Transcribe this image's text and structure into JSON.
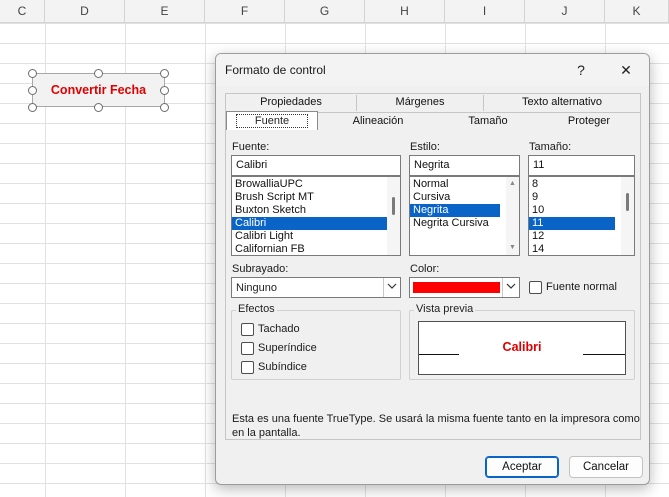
{
  "sheet": {
    "columns": [
      "C",
      "D",
      "E",
      "F",
      "G",
      "H",
      "I",
      "J",
      "K"
    ],
    "shape_label": "Convertir Fecha"
  },
  "dialog": {
    "title": "Formato de control",
    "help_label": "?",
    "close_label": "✕",
    "tabs_row1": [
      "Propiedades",
      "Márgenes",
      "Texto alternativo"
    ],
    "tabs_row2": [
      "Fuente",
      "Alineación",
      "Tamaño",
      "Proteger"
    ],
    "active_tab": "Fuente",
    "font": {
      "label": "Fuente:",
      "value": "Calibri",
      "options": [
        "BrowalliaUPC",
        "Brush Script MT",
        "Buxton Sketch",
        "Calibri",
        "Calibri Light",
        "Californian FB"
      ],
      "selected": "Calibri"
    },
    "style": {
      "label": "Estilo:",
      "value": "Negrita",
      "options": [
        "Normal",
        "Cursiva",
        "Negrita",
        "Negrita Cursiva"
      ],
      "selected": "Negrita"
    },
    "size": {
      "label": "Tamaño:",
      "value": "11",
      "options": [
        "8",
        "9",
        "10",
        "11",
        "12",
        "14"
      ],
      "selected": "11"
    },
    "underline": {
      "label": "Subrayado:",
      "value": "Ninguno"
    },
    "color": {
      "label": "Color:",
      "value": "#ff0000"
    },
    "normal_font": {
      "label": "Fuente normal",
      "checked": false
    },
    "effects": {
      "title": "Efectos",
      "strikethrough": {
        "label": "Tachado",
        "checked": false
      },
      "superscript": {
        "label": "Superíndice",
        "checked": false
      },
      "subscript": {
        "label": "Subíndice",
        "checked": false
      }
    },
    "preview": {
      "title": "Vista previa",
      "sample": "Calibri"
    },
    "note": "Esta es una fuente TrueType. Se usará la misma fuente tanto en la impresora como en la pantalla.",
    "ok_label": "Aceptar",
    "cancel_label": "Cancelar"
  },
  "colors": {
    "accent": "#0a64c8",
    "shape_text": "#e00000",
    "font_color": "#ff0000"
  }
}
